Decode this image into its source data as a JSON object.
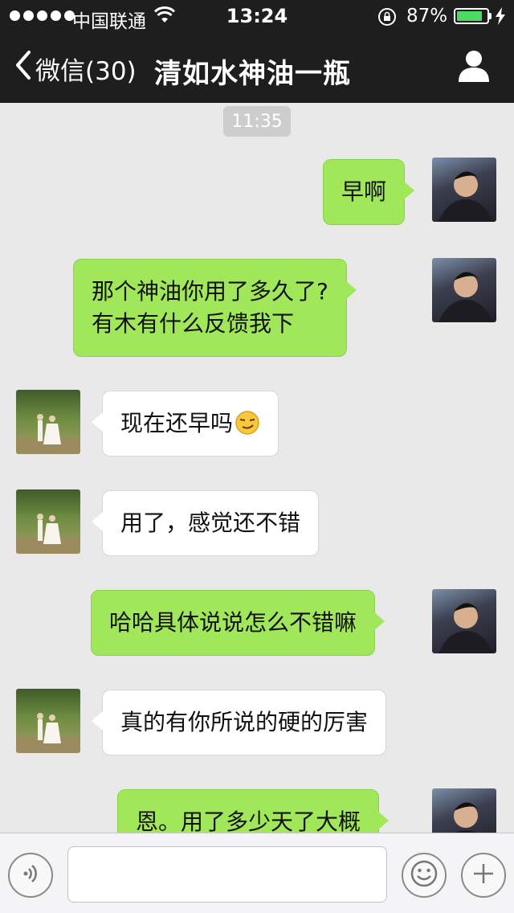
{
  "status_bar": {
    "carrier": "中国联通",
    "time": "13:24",
    "battery_percent": "87%",
    "battery_level": 0.87,
    "battery_color": "#4cd964"
  },
  "nav": {
    "back_label": "微信(30)",
    "title": "清如水神油一瓶",
    "back_icon": "chevron-left-icon",
    "profile_icon": "person-icon"
  },
  "timestamp": "11:35",
  "messages": [
    {
      "sender": "me",
      "text": "早啊"
    },
    {
      "sender": "me",
      "lines": [
        "那个神油你用了多久了?",
        "有木有什么反馈我下"
      ]
    },
    {
      "sender": "them",
      "text": "现在还早吗",
      "emoji": "smirk-emoji-icon"
    },
    {
      "sender": "them",
      "text": "用了，感觉还不错"
    },
    {
      "sender": "me",
      "text": "哈哈具体说说怎么不错嘛"
    },
    {
      "sender": "them",
      "text": "真的有你所说的硬的厉害"
    },
    {
      "sender": "me",
      "text": "恩。用了多少天了大概"
    }
  ],
  "input_bar": {
    "voice_icon": "voice-icon",
    "emoji_icon": "smiley-icon",
    "add_icon": "plus-icon",
    "text_value": ""
  },
  "colors": {
    "nav_background": "#1e1e1e",
    "chat_background": "#e9e9e9",
    "my_bubble": "#a0e75a",
    "their_bubble": "#ffffff"
  }
}
